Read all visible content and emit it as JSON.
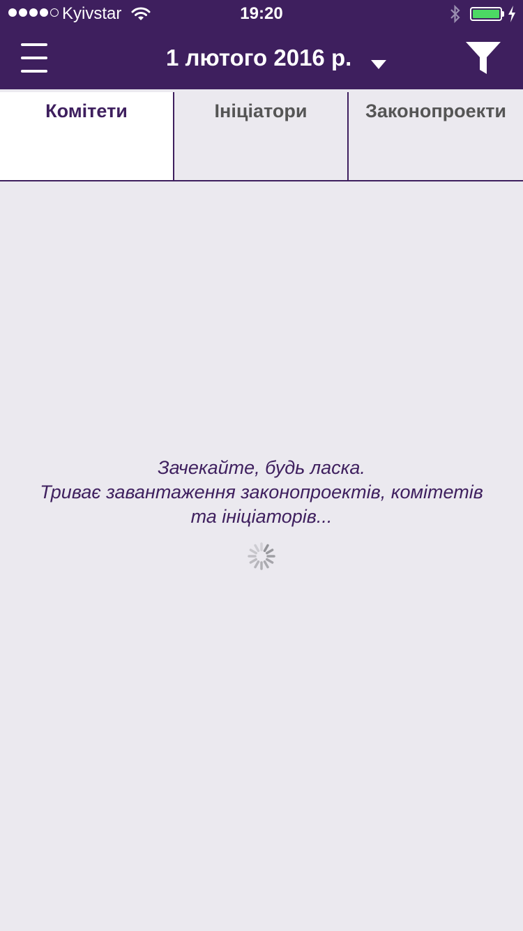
{
  "status_bar": {
    "carrier": "Kyivstar",
    "time": "19:20",
    "signal_bars_filled": 4,
    "signal_bars_total": 5,
    "battery_level": 1.0,
    "charging": true
  },
  "header": {
    "date_title": "1 лютого 2016 р.",
    "menu_icon": "hamburger-icon",
    "dropdown_icon": "caret-down-icon",
    "filter_icon": "filter-icon"
  },
  "tabs": [
    {
      "label": "Комітети",
      "active": true
    },
    {
      "label": "Ініціатори",
      "active": false
    },
    {
      "label": "Законопроекти",
      "active": false
    }
  ],
  "loading": {
    "line1": "Зачекайте, будь ласка.",
    "line2": "Триває завантаження законопроектів, комітетів",
    "line3": "та ініціаторів..."
  },
  "colors": {
    "brand": "#3e1f5e",
    "background": "#ebe9ef",
    "battery": "#4cd964"
  }
}
